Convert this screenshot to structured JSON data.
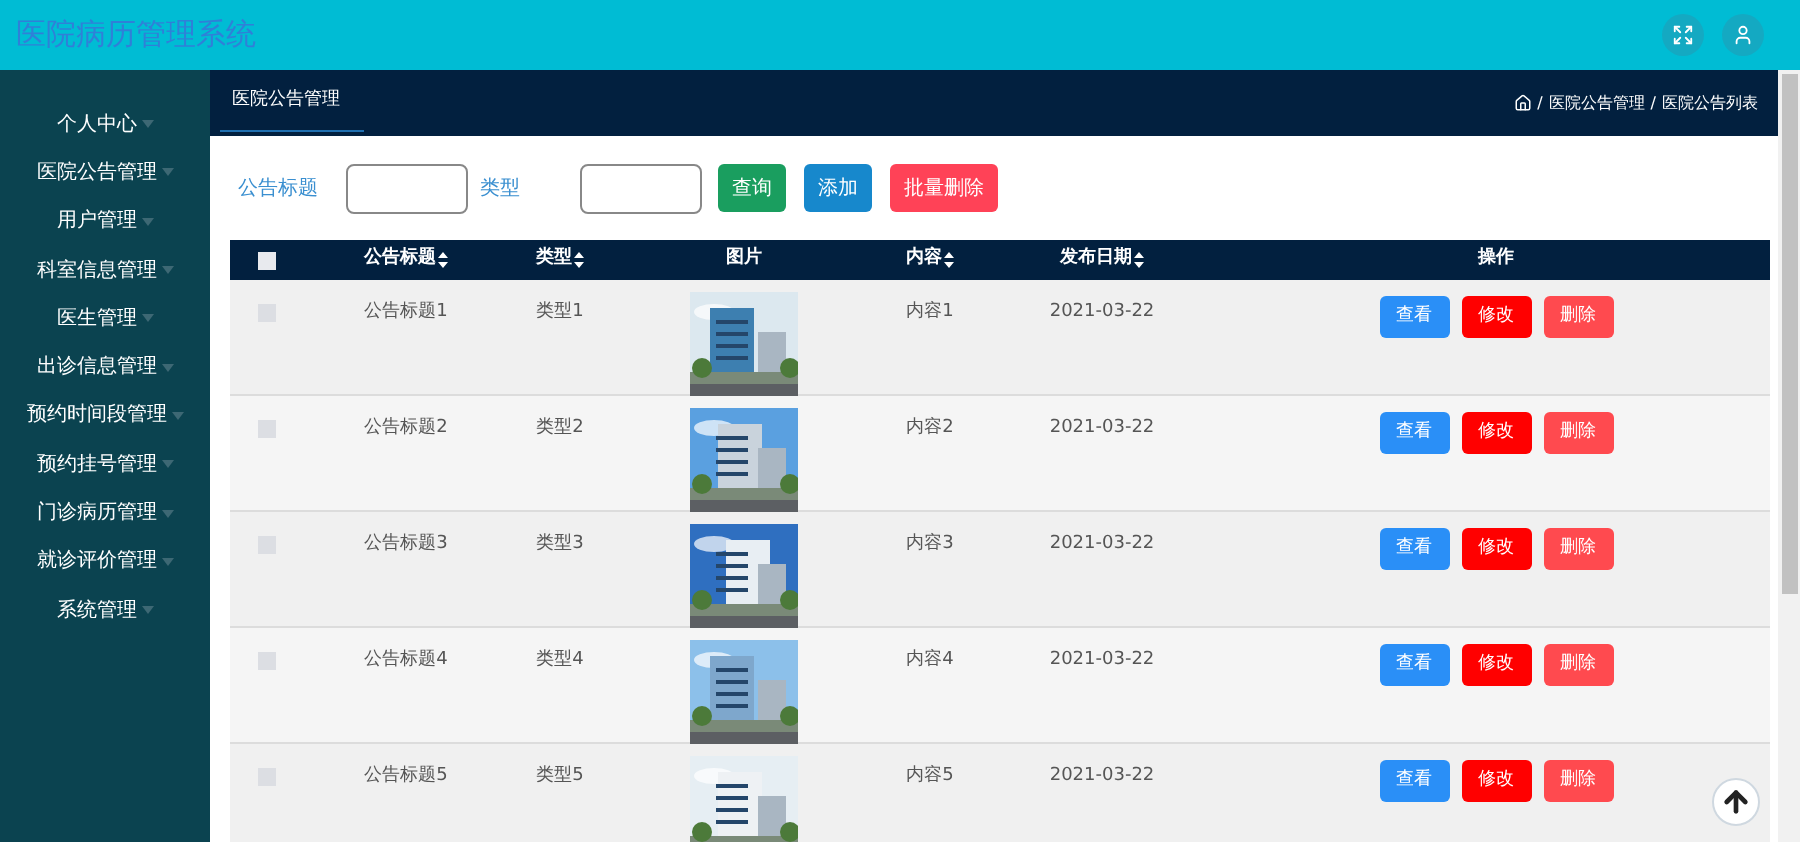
{
  "header": {
    "title": "医院病历管理系统"
  },
  "sidebar": {
    "items": [
      {
        "label": "个人中心"
      },
      {
        "label": "医院公告管理"
      },
      {
        "label": "用户管理"
      },
      {
        "label": "科室信息管理"
      },
      {
        "label": "医生管理"
      },
      {
        "label": "出诊信息管理"
      },
      {
        "label": "预约时间段管理"
      },
      {
        "label": "预约挂号管理"
      },
      {
        "label": "门诊病历管理"
      },
      {
        "label": "就诊评价管理"
      },
      {
        "label": "系统管理"
      }
    ]
  },
  "topbar": {
    "tab": "医院公告管理",
    "breadcrumb_separator": "/",
    "breadcrumb": [
      "医院公告管理",
      "医院公告列表"
    ]
  },
  "filters": [
    {
      "label": "公告标题"
    },
    {
      "label": "类型"
    }
  ],
  "buttons": [
    {
      "label": "查询",
      "kind": "search"
    },
    {
      "label": "添加",
      "kind": "add"
    },
    {
      "label": "批量删除",
      "kind": "batch-delete"
    }
  ],
  "table": {
    "select_all": {
      "checked": false
    },
    "columns": [
      {
        "label": "公告标题",
        "sortable": true
      },
      {
        "label": "类型",
        "sortable": true
      },
      {
        "label": "图片",
        "sortable": false
      },
      {
        "label": "内容",
        "sortable": true
      },
      {
        "label": "发布日期",
        "sortable": true
      },
      {
        "label": "操作",
        "sortable": false
      }
    ],
    "rows": [
      {
        "checked": false,
        "title": "公告标题1",
        "type": "类型1",
        "content": "内容1",
        "date": "2021-03-22",
        "actions": [
          {
            "label": "查看",
            "kind": "view"
          },
          {
            "label": "修改",
            "kind": "edit"
          },
          {
            "label": "删除",
            "kind": "delete"
          }
        ]
      },
      {
        "checked": false,
        "title": "公告标题2",
        "type": "类型2",
        "content": "内容2",
        "date": "2021-03-22",
        "actions": [
          {
            "label": "查看",
            "kind": "view"
          },
          {
            "label": "修改",
            "kind": "edit"
          },
          {
            "label": "删除",
            "kind": "delete"
          }
        ]
      },
      {
        "checked": false,
        "title": "公告标题3",
        "type": "类型3",
        "content": "内容3",
        "date": "2021-03-22",
        "actions": [
          {
            "label": "查看",
            "kind": "view"
          },
          {
            "label": "修改",
            "kind": "edit"
          },
          {
            "label": "删除",
            "kind": "delete"
          }
        ]
      },
      {
        "checked": false,
        "title": "公告标题4",
        "type": "类型4",
        "content": "内容4",
        "date": "2021-03-22",
        "actions": [
          {
            "label": "查看",
            "kind": "view"
          },
          {
            "label": "修改",
            "kind": "edit"
          },
          {
            "label": "删除",
            "kind": "delete"
          }
        ]
      },
      {
        "checked": false,
        "title": "公告标题5",
        "type": "类型5",
        "content": "内容5",
        "date": "2021-03-22",
        "actions": [
          {
            "label": "查看",
            "kind": "view"
          },
          {
            "label": "修改",
            "kind": "edit"
          },
          {
            "label": "删除",
            "kind": "delete"
          }
        ]
      }
    ]
  }
}
